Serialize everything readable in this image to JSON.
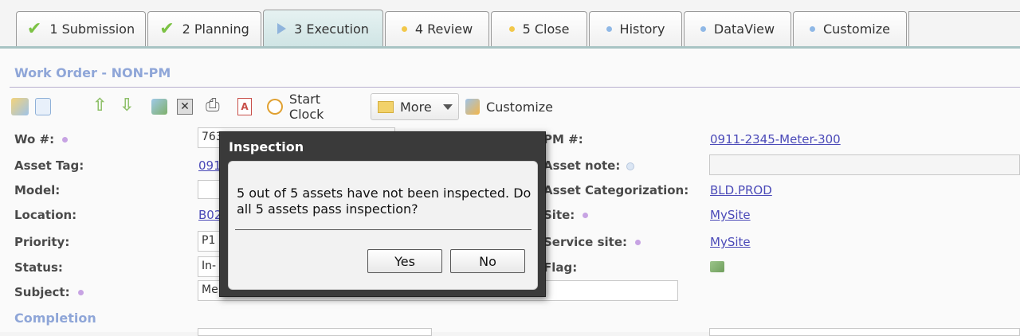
{
  "tabs": [
    {
      "label": "1 Submission",
      "icon": "check-icon"
    },
    {
      "label": "2 Planning",
      "icon": "check-icon"
    },
    {
      "label": "3 Execution",
      "icon": "play-icon",
      "active": true
    },
    {
      "label": "4 Review",
      "icon": "yellow-dot-icon"
    },
    {
      "label": "5 Close",
      "icon": "yellow-dot-icon"
    },
    {
      "label": "History",
      "icon": "blue-dot-icon"
    },
    {
      "label": "DataView",
      "icon": "blue-dot-icon"
    },
    {
      "label": "Customize",
      "icon": "blue-dot-icon"
    }
  ],
  "page": {
    "title": "Work Order - NON-PM",
    "completion_title": "Completion"
  },
  "toolbar": {
    "start_clock_label": "Start Clock",
    "more_label": "More",
    "customize_label": "Customize"
  },
  "fields": {
    "wo_label": "Wo #:",
    "wo_value": "763",
    "asset_tag_label": "Asset Tag:",
    "asset_tag_value": "091",
    "model_label": "Model:",
    "location_label": "Location:",
    "location_value": "B02",
    "priority_label": "Priority:",
    "priority_value": "P1",
    "status_label": "Status:",
    "status_value": "In-",
    "subject_label": "Subject:",
    "subject_value": "Me",
    "pm_label": "PM #:",
    "pm_value": "0911-2345-Meter-300",
    "asset_note_label": "Asset note:",
    "asset_cat_label": "Asset Categorization:",
    "asset_cat_value": "BLD.PROD",
    "site_label": "Site:",
    "site_value": "MySite",
    "service_site_label": "Service site:",
    "service_site_value": "MySite",
    "flag_label": "Flag:"
  },
  "dialog": {
    "title": "Inspection",
    "message": "5 out of 5 assets have not been inspected. Do all 5 assets pass inspection?",
    "yes_label": "Yes",
    "no_label": "No"
  },
  "colors": {
    "accent_title": "#8fa6d8",
    "link": "#4b4ab8",
    "check_green": "#7cc244"
  }
}
